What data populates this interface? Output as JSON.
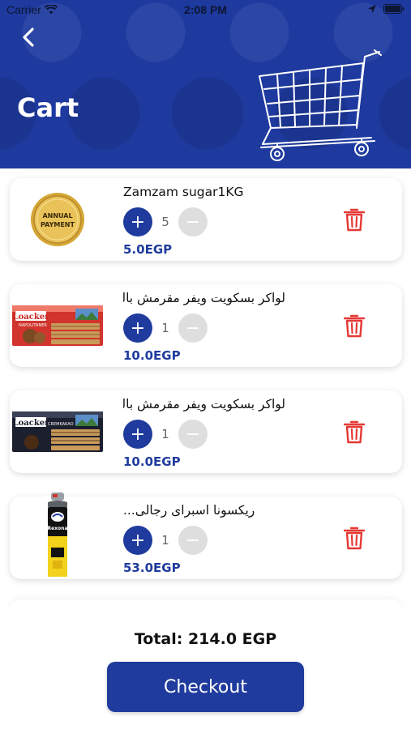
{
  "status_bar": {
    "carrier": "Carrier",
    "time": "2:08 PM"
  },
  "header": {
    "title": "Cart",
    "back_icon": "chevron-left-icon",
    "illustration": "shopping-cart-icon",
    "background_color": "#1e3a9f"
  },
  "cart_items": [
    {
      "name": "Zamzam sugar1KG",
      "quantity": "5",
      "price": "5.0EGP",
      "image_text": [
        "ANNUAL",
        "PAYMENT"
      ]
    },
    {
      "name": "لواكر بسكويت ويفر مقرمش بالبند...",
      "quantity": "1",
      "price": "10.0EGP",
      "image_text": [
        "Loacker",
        "NAPOLITANER"
      ]
    },
    {
      "name": "لواكر بسكويت ويفر مقرمش بالكاك...",
      "quantity": "1",
      "price": "10.0EGP",
      "image_text": [
        "Loacker",
        "CREMKAKAO"
      ]
    },
    {
      "name": "ريكسونا اسبراى رجالى...",
      "quantity": "1",
      "price": "53.0EGP",
      "image_text": [
        "Rexona"
      ]
    }
  ],
  "controls": {
    "plus": "+",
    "minus": "−"
  },
  "footer": {
    "total": "Total: 214.0 EGP",
    "checkout_label": "Checkout"
  },
  "colors": {
    "primary": "#1f3b9d",
    "delete": "#e53935",
    "minus_disabled": "#dedede"
  }
}
